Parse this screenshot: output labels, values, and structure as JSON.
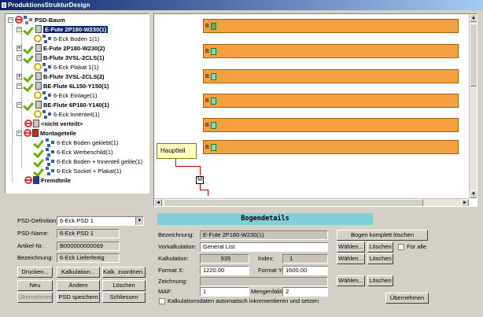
{
  "window": {
    "title": "ProduktionsStrukturDesign"
  },
  "tree": {
    "root": "PSD-Baum",
    "nodes": [
      "E-Fute 2P180-W230(1)",
      "6-Eck Boden 1(1)",
      "E-Fute 2P180-W230(2)",
      "B-Flute 3VSL-2CLS(1)",
      "6-Eck Plakat 1(1)",
      "B-Flute 3VSL-2CLS(2)",
      "BE-Flute 6L150-Y150(1)",
      "6-Eck Einlage(1)",
      "BE-Flute 6P160-Y140(1)",
      "6-Eck Innenteil(1)",
      "<nicht verteilt>",
      "Montageteile",
      "6-Eck Boden geklebt(1)",
      "6-Eck Werbeschild(1)",
      "6-Eck Boden + Innenteil gekle(1)",
      "6-Eck Sockel + Plakat(1)",
      "Fremdteile"
    ]
  },
  "diagram": {
    "bar_prefix": "B",
    "hauptteil": "Hauptteil",
    "m_label": "M"
  },
  "form": {
    "psd_definition_label": "PSD-Definition:",
    "psd_definition_value": "6-Eck PSD 1",
    "psd_name_label": "PSD-Name:",
    "psd_name_value": "6-Eck PSD 1",
    "artikel_label": "Artikel-Nr.",
    "artikel_value": "B000000000069",
    "bezeichnung_label": "Bezeichnung:",
    "bezeichnung_value": "6-Eck Lieferfertig",
    "buttons": {
      "drucken": "Drucken...",
      "kalkulation": "Kalkulation...",
      "kalk_zuordnen": "Kalk. zuordnen...",
      "neu": "Neu",
      "aendern": "Ändern",
      "loeschen": "Löschen",
      "uebernehmen": "Übernehmen",
      "psd_speichern": "PSD speichern",
      "schliessen": "Schliessen"
    }
  },
  "details": {
    "header": "Bogendetails",
    "bezeichnung_label": "Bezeichnung:",
    "bezeichnung_value": "E-Fute 2P180-W230(1)",
    "vorkalkulation_label": "Vorkalkulation:",
    "vorkalkulation_value": "General List",
    "kalkulation_label": "Kalkulation:",
    "kalkulation_value": "535",
    "index_label": "Index:",
    "index_value": "1",
    "format_x_label": "Format X:",
    "format_x_value": "1220.00",
    "format_y_label": "Format Y:",
    "format_y_value": "1600.00",
    "zeichnung_label": "Zeichnung:",
    "maf_label": "MAF:",
    "maf_value": "1",
    "mengenfaktor_label": "Mengenfaktor:",
    "mengenfaktor_value": "2",
    "auto_increment_label": "Kalkulationsdaten automatisch inkrementieren und setzen",
    "bogen_loeschen": "Bogen komplett löschen",
    "waehlen": "Wählen...",
    "loeschen": "Löschen",
    "fuer_alle": "Für alle",
    "uebernehmen": "Übernehmen"
  }
}
